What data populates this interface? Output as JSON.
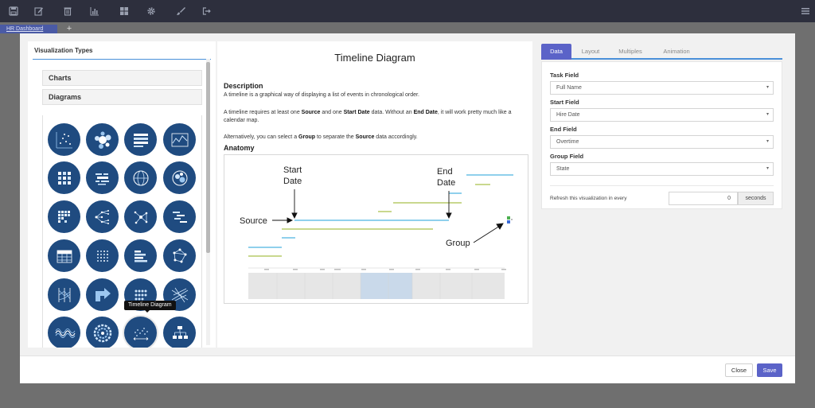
{
  "tabs": {
    "dashboard": "HR Dashboard",
    "add": "+"
  },
  "left": {
    "title": "Visualization Types",
    "charts_label": "Charts",
    "diagrams_label": "Diagrams",
    "tooltip": "Timeline Diagram"
  },
  "main": {
    "title": "Timeline Diagram",
    "description_heading": "Description",
    "p1": "A timeline is a graphical way of displaying a list of events in chronological order.",
    "p2_a": "A timeline requires at least one ",
    "p2_source": "Source",
    "p2_b": " and one ",
    "p2_start": "Start Date",
    "p2_c": " data. Without an ",
    "p2_end": "End Date",
    "p2_d": ", it will work pretty much like a calendar map.",
    "p3_a": "Alternatively, you can select a ",
    "p3_group": "Group",
    "p3_b": " to separate the ",
    "p3_source": "Source",
    "p3_c": " data accordingly.",
    "anatomy_heading": "Anatomy",
    "anatomy": {
      "start_label_1": "Start",
      "start_label_2": "Date",
      "end_label_1": "End",
      "end_label_2": "Date",
      "source_label": "Source",
      "group_label": "Group"
    }
  },
  "right": {
    "tabs": [
      "Data",
      "Layout",
      "Multiples",
      "Animation"
    ],
    "task_field_label": "Task Field",
    "task_field_value": "Full Name",
    "start_field_label": "Start Field",
    "start_field_value": "Hire Date",
    "end_field_label": "End Field",
    "end_field_value": "Overtime",
    "group_field_label": "Group Field",
    "group_field_value": "State",
    "refresh_label": "Refresh this visualization in every",
    "refresh_value": "0",
    "refresh_unit": "seconds"
  },
  "footer": {
    "close": "Close",
    "save": "Save"
  },
  "icons": {
    "toolbar": [
      "save-icon",
      "edit-icon",
      "trash-icon",
      "bar-chart-icon",
      "dashboard-grid-icon",
      "gear-icon",
      "brush-icon",
      "sign-out-icon"
    ],
    "toolbar_right": "menu-icon"
  },
  "colors": {
    "accent": "#5b63c8",
    "icon_bg": "#1f4b80",
    "topbar": "#2d2f3d"
  }
}
